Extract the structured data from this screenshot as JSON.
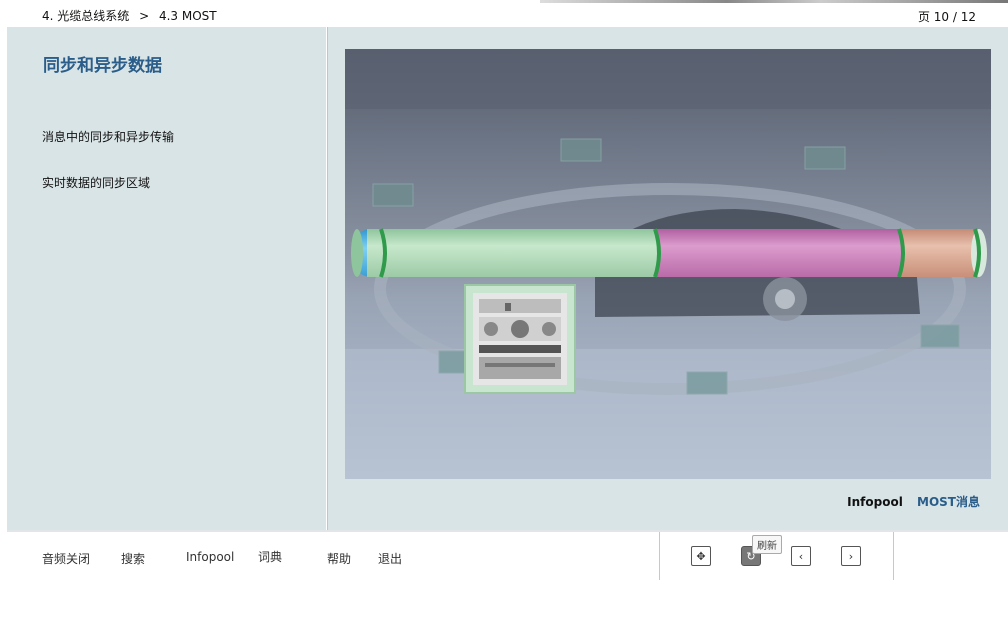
{
  "header": {
    "crumb_chapter": "4. 光缆总线系统",
    "crumb_sep": ">",
    "crumb_section": "4.3 MOST",
    "page_indicator": "页 10 / 12"
  },
  "sidebar": {
    "title": "同步和异步数据",
    "items": [
      {
        "label": "消息中的同步和异步传输"
      },
      {
        "label": "实时数据的同步区域"
      }
    ]
  },
  "main": {
    "links": {
      "infopool": "Infopool",
      "most_message": "MOST消息"
    },
    "colors": {
      "bar_blue": "#4ab2e0",
      "bar_green": "#b4dcbc",
      "bar_magenta": "#c77bb4",
      "bar_tan": "#d8a58f",
      "bar_divider": "#2e9a4a",
      "link_active": "#2a5d8a"
    }
  },
  "footer": {
    "nav": [
      "音频关闭",
      "搜索",
      "Infopool",
      "词典",
      "帮助",
      "退出"
    ],
    "controls": [
      {
        "name": "move",
        "icon": "move-arrows-icon"
      },
      {
        "name": "refresh",
        "icon": "refresh-icon"
      },
      {
        "name": "previous",
        "icon": "chevron-left-icon"
      },
      {
        "name": "next",
        "icon": "chevron-right-icon"
      }
    ],
    "tooltip": "刷新"
  }
}
